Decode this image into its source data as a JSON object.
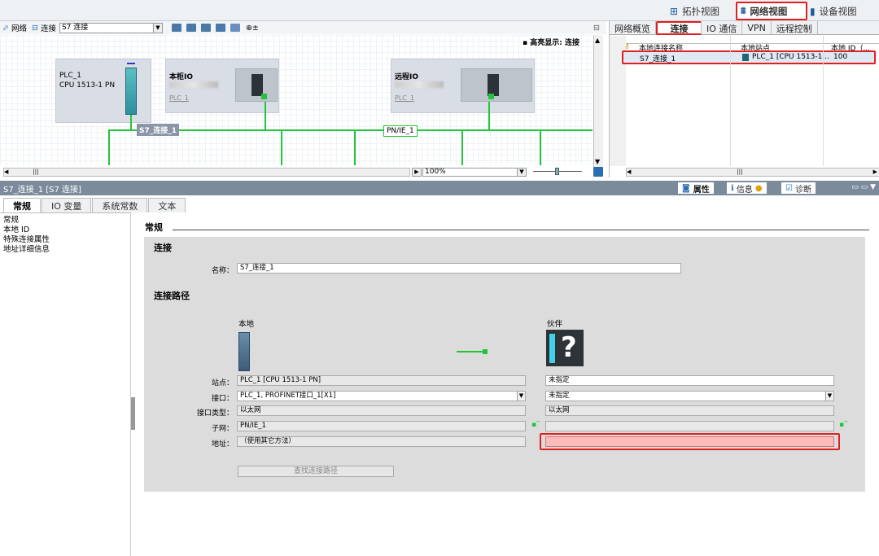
{
  "view_switch": {
    "topology": "拓扑视图",
    "network": "网络视图",
    "device": "设备视图"
  },
  "toolbar": {
    "network": "网络",
    "connection": "连接",
    "connection_type": "S7 连接"
  },
  "canvas": {
    "highlight": "高亮显示: 连接",
    "plc_name": "PLC_1",
    "plc_cpu": "CPU 1513-1 PN",
    "local_io": "本柜IO",
    "local_io_plc": "PLC_1",
    "remote_io": "远程IO",
    "remote_io_plc": "PLC_1",
    "conn_label": "S7_连接_1",
    "subnet_label": "PN/IE_1",
    "zoom": "100%"
  },
  "rpanel": {
    "tabs": [
      "网络概览",
      "连接",
      "IO 通信",
      "VPN",
      "远程控制"
    ],
    "columns": [
      "本地连接名称",
      "本地站点",
      "本地 ID（..."
    ],
    "rows": [
      [
        "S7_连接_1",
        "PLC_1 [CPU 1513-1...",
        "100"
      ]
    ]
  },
  "inspector": {
    "title": "S7_连接_1 [S7 连接]",
    "tab_props": "属性",
    "tab_info": "信息",
    "tab_diag": "诊断",
    "subtabs": [
      "常规",
      "IO 变量",
      "系统常数",
      "文本"
    ]
  },
  "nav": [
    "常规",
    "本地 ID",
    "特殊连接属性",
    "地址详细信息"
  ],
  "form": {
    "section": "常规",
    "conn_title": "连接",
    "name_label": "名称：",
    "name_value": "S7_连接_1",
    "path_title": "连接路径",
    "local": "本地",
    "partner": "伙伴",
    "station_label": "站点：",
    "station_local": "PLC_1 [CPU 1513-1 PN]",
    "station_partner": "未指定",
    "interface_label": "接口：",
    "interface_local": "PLC_1, PROFINET接口_1[X1]",
    "interface_partner": "未指定",
    "iftype_label": "接口类型：",
    "iftype_local": "以太网",
    "iftype_partner": "以太网",
    "subnet_label": "子网：",
    "subnet_local": "PN/IE_1",
    "subnet_partner": "",
    "address_label": "地址：",
    "address_local": "（使用其它方法）",
    "address_partner": "",
    "find_path": "查找连接路径"
  },
  "colors": {
    "accent_red": "#e02020",
    "subnet_green": "#22c53a",
    "title_bar": "#7c8b9c"
  }
}
